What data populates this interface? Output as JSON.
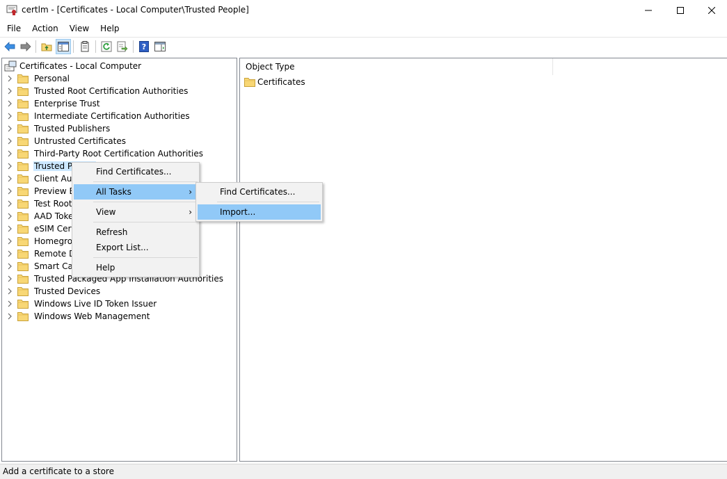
{
  "window": {
    "title": "certlm - [Certificates - Local Computer\\Trusted People]",
    "icon": "certificate-snapin-icon"
  },
  "menubar": {
    "items": [
      "File",
      "Action",
      "View",
      "Help"
    ]
  },
  "toolbar": {
    "buttons": [
      "back-arrow-icon",
      "forward-arrow-icon",
      "up-folder-icon",
      "show-hide-tree-icon",
      "properties-icon",
      "refresh-icon",
      "export-list-icon",
      "help-icon",
      "action-pane-icon"
    ]
  },
  "tree": {
    "root_label": "Certificates - Local Computer",
    "items": [
      "Personal",
      "Trusted Root Certification Authorities",
      "Enterprise Trust",
      "Intermediate Certification Authorities",
      "Trusted Publishers",
      "Untrusted Certificates",
      "Third-Party Root Certification Authorities",
      "Trusted People",
      "Client Authentication Issuers",
      "Preview Build Roots",
      "Test Roots",
      "AAD Token Issuer",
      "eSIM Certification Authorities",
      "Homegroup Machine Certificates",
      "Remote Desktop",
      "Smart Card Trusted Roots",
      "Trusted Packaged App Installation Authorities",
      "Trusted Devices",
      "Windows Live ID Token Issuer",
      "Windows Web Management"
    ],
    "selected": "Trusted People"
  },
  "list": {
    "column_header": "Object Type",
    "rows": [
      "Certificates"
    ]
  },
  "context_menu": {
    "items": [
      "Find Certificates...",
      "All Tasks",
      "View",
      "Refresh",
      "Export List...",
      "Help"
    ],
    "highlighted": "All Tasks"
  },
  "submenu": {
    "items": [
      "Find Certificates...",
      "Import..."
    ],
    "highlighted": "Import..."
  },
  "statusbar": {
    "text": "Add a certificate to a store"
  },
  "colors": {
    "highlight": "#91c9f7",
    "selection": "#cce8ff",
    "folder": "#f8d775"
  }
}
